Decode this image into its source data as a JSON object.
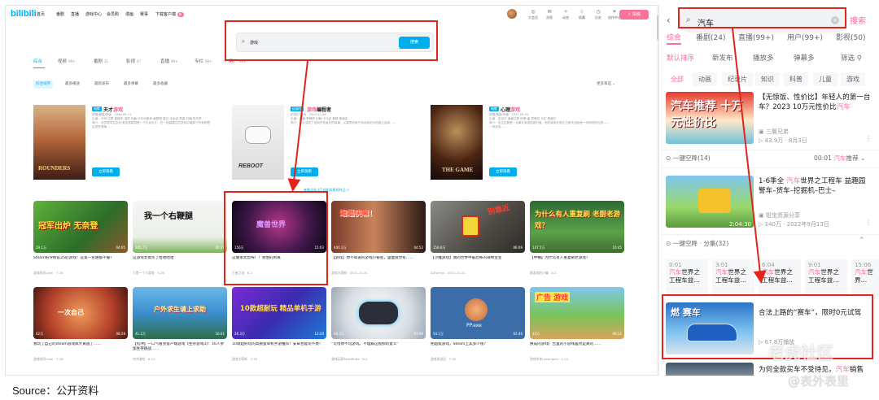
{
  "desktop": {
    "logo": "bilibili",
    "nav": [
      "首页",
      "番剧",
      "直播",
      "游戏中心",
      "会员购",
      "漫画",
      "赛事",
      "下载客户端"
    ],
    "nav_badge": "新",
    "top_icons": [
      "大会员",
      "消息",
      "动态",
      "收藏",
      "历史",
      "创作中心"
    ],
    "upload_label": "投稿",
    "search": {
      "value": "游戏",
      "button": "搜索"
    },
    "tabs": [
      {
        "label": "综合",
        "count": ""
      },
      {
        "label": "视频",
        "count": "99+"
      },
      {
        "label": "番剧",
        "count": "21"
      },
      {
        "label": "影视",
        "count": "47"
      },
      {
        "label": "直播",
        "count": "99+"
      },
      {
        "label": "专栏",
        "count": "99+"
      },
      {
        "label": "用户",
        "count": "99+"
      }
    ],
    "sort": [
      "综合排序",
      "最多播放",
      "最新发布",
      "最多弹幕",
      "最多收藏"
    ],
    "more_filters": "更多筛选",
    "movies": [
      {
        "tag": "电影",
        "title_pre": "天才",
        "title_hl": "游戏",
        "title_post": "",
        "meta": "剧情/悬疑/惊悚 · 1998-09-11\n出演：马特·达蒙 爱德华·诺顿 约翰·马尔科维奇 格蕾琴·莫尔 法米克·詹森 约翰·特托罗\n简介：法学院学生迈克·麦克德莫特是一个扑克天才，在一场高赌注的游戏中输掉了所有积蓄后发誓戒赌……",
        "poster_text": "ROUNDERS",
        "button": "立即观看"
      },
      {
        "tag": "纪录片",
        "title_pre": "",
        "title_hl": "游戏",
        "title_post": "编程者",
        "meta": "纪录片/游戏 · 2019-11-26\n出演：约翰·罗梅罗 约翰·卡马克 蒂姆·斯威尼\n简介：本片讲述了游戏开发者们的故事，从最早的电子游戏到如今的独立游戏……",
        "poster_text": "REBOOT",
        "button": "立即观看"
      },
      {
        "tag": "电影",
        "title_pre": "心理",
        "title_hl": "游戏",
        "title_post": "",
        "meta": "剧情/悬疑/惊悚 · 1997-09-03\n出演：迈克尔·道格拉斯 西恩·潘 黛博拉·卡拉·昂格尔\n简介：尼古拉斯是一位事业有成的银行家，他的弟弟在他生日那天送给他一份特别的礼物——一场游戏……",
        "poster_text": "THE GAME",
        "button": "立即观看"
      }
    ],
    "more_link": "查看全部 47 部相关影视作品 >",
    "videos": [
      {
        "thumb_text": "冠军出炉 无奈登",
        "stat": "29.1万",
        "dur": "04:05",
        "title": "Steam好评榜前25的游戏！这第一名谁都不服？",
        "up": "游戏时间Leon · 7-26"
      },
      {
        "thumb_text": "我一个右鞭腿",
        "stat": "285.7万",
        "dur": "00:19",
        "title": "这游戏太搞笑了哈哈哈哈",
        "up": "只是一个小游戏 · 3-26"
      },
      {
        "thumb_text": "魔兽世界",
        "stat": "156万",
        "dur": "15:03",
        "title": "这簡单太恐怖！！害怕的到来",
        "up": "王者之战 · 6-2"
      },
      {
        "thumb_text": "蝙蝠侠嘛！",
        "stat": "400.1万",
        "dur": "04:52",
        "title": "【游戏】你不知道的游戏小秘密，里面竟然有……",
        "up": "游戏大萌新 · 2022-10-31"
      },
      {
        "thumb_text": "别靠近",
        "stat": "158.6万",
        "dur": "06:09",
        "title": "【沙雕游戏】我的世界中最恐怖的海绵宝宝",
        "up": "ZZherrys · 2021-11-21"
      },
      {
        "thumb_text": "为什么有人重复刷 老厨老游戏？",
        "stat": "147.5万",
        "dur": "10:45",
        "title": "【中横】为什么有人重复刷老游戏？",
        "up": "刷游戏的小编 · 8-2"
      },
      {
        "thumb_text": "一次自己",
        "stat": "62万",
        "dur": "08:28",
        "title": "我玩了自己的steam游戏库大黄遇了……",
        "up": "游戏时间Leon · 7-26"
      },
      {
        "thumb_text": "户外求生请上求助",
        "stat": "41.2万",
        "dur": "16:01",
        "title": "【何冲】一口气看完客户端游戏《生存游戏3》：16人参加生存挑战……",
        "up": "何冲游戏 · 6-10"
      },
      {
        "thumb_text": "10款超耐玩 精品单机手游",
        "stat": "26.3万",
        "dur": "12:20",
        "title": "10款超好玩的高质量单机手游推荐！安卓也能玩不费！",
        "up": "游戏大萌新 · 7-25"
      },
      {
        "thumb_text": "",
        "stat": "66.2万",
        "dur": "03:09",
        "title": "“可惜你不玩游戏，不理解这视频的意义”",
        "up": "游戏玩家BestWhite · 8-4"
      },
      {
        "thumb_text": "PP.exe",
        "stat": "54.1万",
        "dur": "02:46",
        "title": "把超能游戏，Steam上卖多少钱？",
        "up": "游戏测试员 · 7-25"
      },
      {
        "thumb_text": "广告 游戏",
        "stat": "43万",
        "dur": "06:32",
        "title": "换成的游戏广告里的小游戏居然是真的……",
        "up": "游戏伙伴Leeangela · 4-10"
      }
    ]
  },
  "mobile": {
    "search": {
      "value": "汽车",
      "button": "搜索"
    },
    "tabs": [
      "综合",
      "番剧(24)",
      "直播(99+)",
      "用户(99+)",
      "影视(50)"
    ],
    "sort": [
      "默认排序",
      "新发布",
      "播放多",
      "弹幕多",
      "筛选"
    ],
    "chips": [
      "全部",
      "动画",
      "纪录片",
      "知识",
      "科普",
      "儿童",
      "游戏"
    ],
    "items": [
      {
        "thumb_text": "汽车推荐 十万元性价比",
        "title_pre": "【无惊饭、性价比】年轻人的第一台车？2023 10万元性价比",
        "title_hl": "汽车",
        "title_post": "",
        "up": "三層兄弟",
        "stat": "43.9万 · 8月3日",
        "dur": ""
      },
      {
        "thumb_text": "",
        "title_pre": "1-6季全 ",
        "title_hl": "汽车",
        "title_post": "世界之工程车 益趣园 警车–货车–挖掘机–巴士–",
        "up": "铅宝资源分享",
        "stat": "140万 · 2022年9月13日",
        "dur": "2:04:30"
      },
      {
        "thumb_text": "燃 赛车",
        "title_pre": "合法上路的“赛车”，限时0元试驾",
        "title_hl": "",
        "title_post": "",
        "up": "67.8万播放",
        "stat": "",
        "dur": ""
      },
      {
        "thumb_text": "",
        "title_pre": "为何全款买车不受待见，",
        "title_hl": "汽车",
        "title_post": "销售",
        "up": "",
        "stat": "",
        "dur": ""
      }
    ],
    "oneclick1": {
      "label": "一键空降(14)",
      "right_time": "00:01 ",
      "right_hl": "汽车",
      "right_post": "推荐 ⌄"
    },
    "oneclick2": {
      "label": "一键空降 · 分集(32)"
    },
    "episodes": [
      {
        "t": "0:01",
        "n_hl": "汽车",
        "n_post": "世界之工程车益…"
      },
      {
        "t": "3:01",
        "n_hl": "汽车",
        "n_post": "世界之工程车益…"
      },
      {
        "t": "6:04",
        "n_hl": "汽车",
        "n_post": "世界之工程车益…"
      },
      {
        "t": "9:01",
        "n_hl": "汽车",
        "n_post": "世界之工程车益…"
      },
      {
        "t": "15:06",
        "n_hl": "汽车",
        "n_post": "世界…"
      }
    ]
  },
  "caption": "Source：公开资料",
  "watermarks": [
    "老虎社区",
    "@表外表里"
  ],
  "colors": {
    "brand": "#00aeec",
    "pink": "#fb7299",
    "annotation": "#e1251b"
  }
}
